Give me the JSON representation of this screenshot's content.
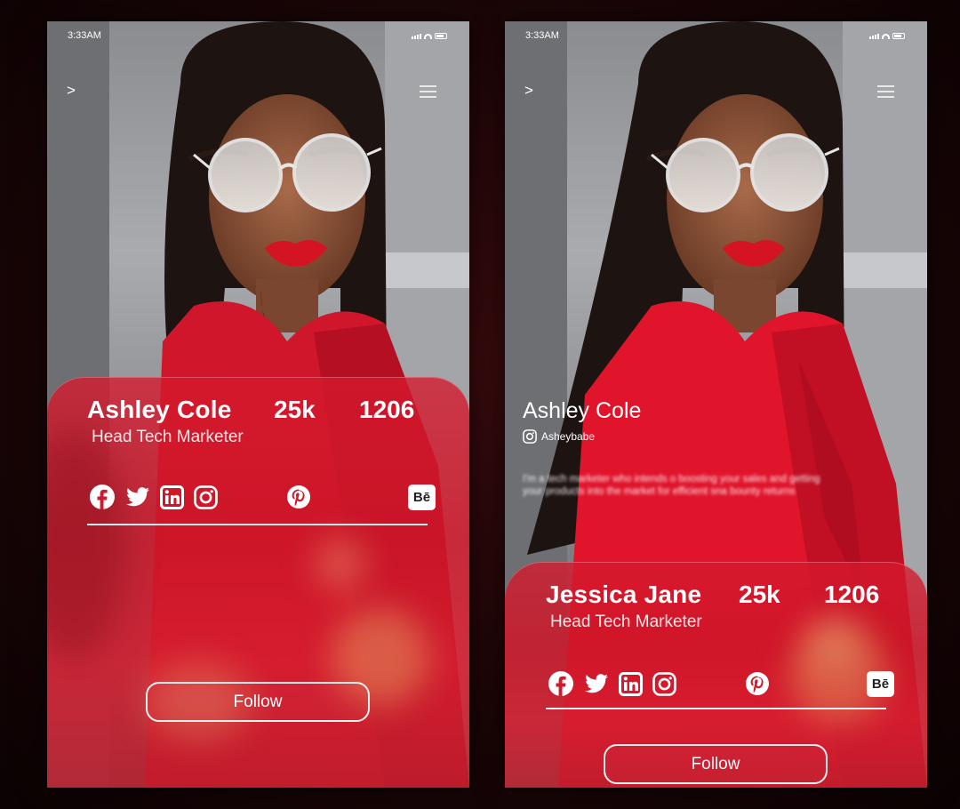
{
  "colors": {
    "accent_red": "#d6192d",
    "text_white": "#ffffff"
  },
  "status_bar": {
    "time": "3:33AM"
  },
  "nav": {
    "back_glyph": ">",
    "menu_icon": "hamburger-icon"
  },
  "screens": [
    {
      "profile": {
        "name": "Ashley Cole",
        "role": "Head Tech Marketer",
        "stat_1": "25k",
        "stat_2": "1206"
      },
      "socials": [
        "facebook-icon",
        "twitter-icon",
        "linkedin-icon",
        "instagram-icon",
        "pinterest-icon",
        "behance-icon"
      ],
      "behance_label": "Bē",
      "follow_label": "Follow"
    },
    {
      "bio": {
        "name": "Ashley Cole",
        "handle": "Asheybabe",
        "text": "I'm a tech marketer who intends o boosting your sales and getting your products into the market for efficient sna bounty returns"
      },
      "profile": {
        "name": "Jessica Jane",
        "role": "Head Tech Marketer",
        "stat_1": "25k",
        "stat_2": "1206"
      },
      "socials": [
        "facebook-icon",
        "twitter-icon",
        "linkedin-icon",
        "instagram-icon",
        "pinterest-icon",
        "behance-icon"
      ],
      "behance_label": "Bē",
      "follow_label": "Follow"
    }
  ]
}
